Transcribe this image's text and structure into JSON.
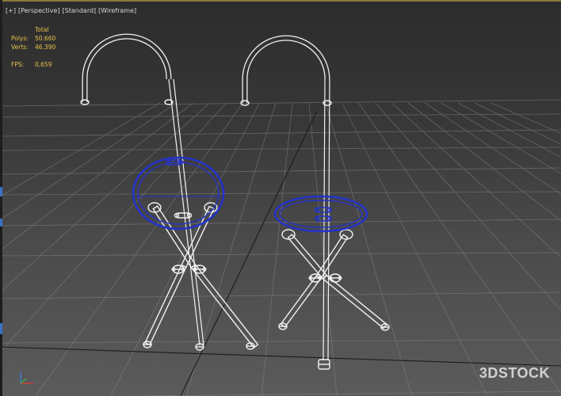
{
  "viewport": {
    "label_parts": [
      "[+]",
      "[Perspective]",
      "[Standard]",
      "[Wireframe]"
    ],
    "accent_color": "#e8c34a",
    "selection_color": "#2433c8",
    "wire_color": "#f2f2f2"
  },
  "stats": {
    "header": "Total",
    "rows": [
      {
        "label": "Polys:",
        "value": "50.660"
      },
      {
        "label": "Verts:",
        "value": "46.390"
      }
    ],
    "fps_label": "FPS:",
    "fps_value": "0,659"
  },
  "watermark": "3DSTOCK",
  "icons": {
    "axis_gizmo": "xyz-axis-icon"
  }
}
